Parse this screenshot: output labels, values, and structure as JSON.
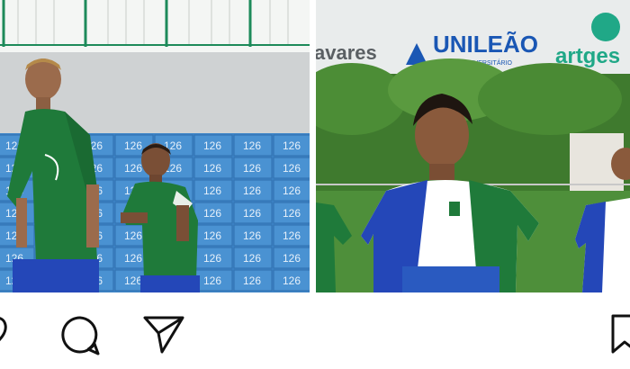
{
  "left_photo": {
    "wall_number": "126",
    "alt": "Two young soccer players in green and white jerseys"
  },
  "right_photo": {
    "sponsor_1": "avares",
    "sponsor_2": "UNILEÃO",
    "sponsor_2_sub": "CENTRO UNIVERSITÁRIO",
    "sponsor_3": "artges",
    "alt": "Smiling young soccer player in blue, white and green jersey"
  },
  "actions": {
    "like": "heart-icon",
    "comment": "comment-icon",
    "share": "share-icon",
    "save": "bookmark-icon"
  },
  "colors": {
    "jersey_green": "#1f7a3a",
    "jersey_blue": "#2447b8",
    "wall_blue": "#3f86c8",
    "field_green": "#4e8f3a"
  }
}
